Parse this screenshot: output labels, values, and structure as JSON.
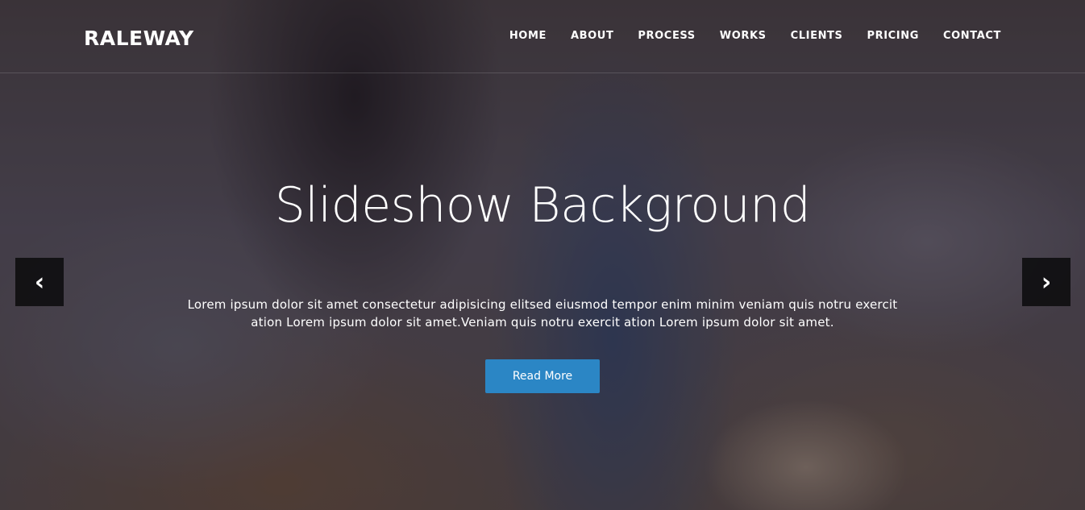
{
  "brand": {
    "name": "RALEWAY"
  },
  "nav": {
    "items": [
      {
        "label": "HOME"
      },
      {
        "label": "ABOUT"
      },
      {
        "label": "PROCESS"
      },
      {
        "label": "WORKS"
      },
      {
        "label": "CLIENTS"
      },
      {
        "label": "PRICING"
      },
      {
        "label": "CONTACT"
      }
    ]
  },
  "hero": {
    "title": "Slideshow Background",
    "description": "Lorem ipsum dolor sit amet consectetur adipisicing elitsed eiusmod tempor enim minim veniam quis notru exercit ation Lorem ipsum dolor sit amet.Veniam quis notru exercit ation Lorem ipsum dolor sit amet.",
    "button_label": "Read More"
  },
  "slider": {
    "prev_icon": "‹",
    "next_icon": "›"
  },
  "colors": {
    "button": "#2b86c5",
    "text": "#ffffff",
    "arrow_bg": "#0a0a0c"
  },
  "icons": {
    "prev": "chevron-left-icon",
    "next": "chevron-right-icon"
  }
}
